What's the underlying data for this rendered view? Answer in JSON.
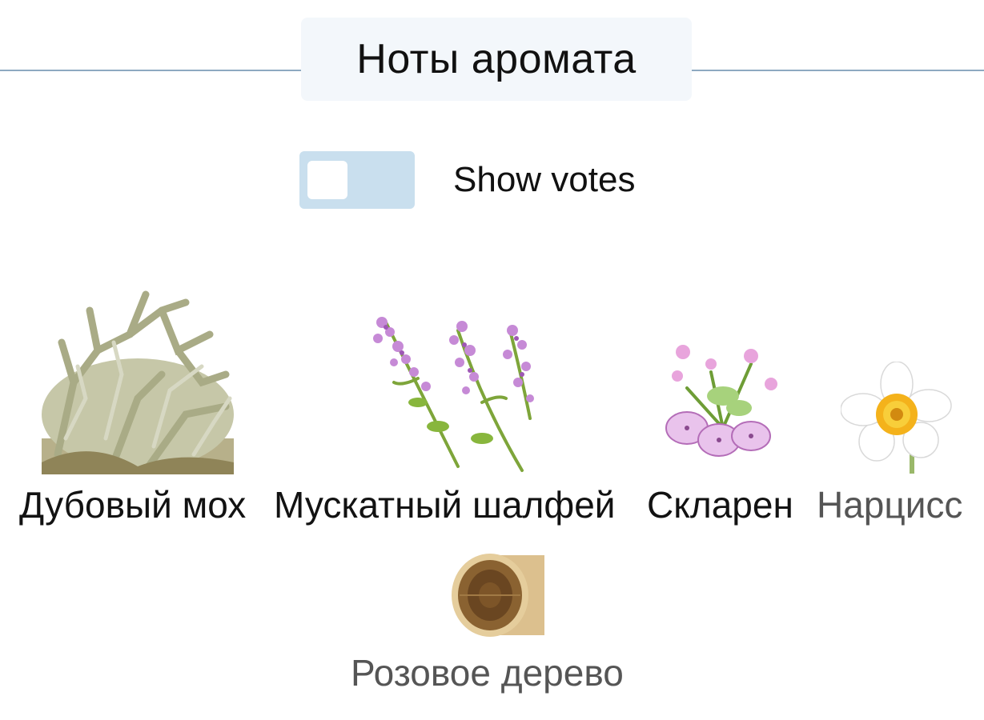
{
  "section": {
    "title": "Ноты аромата"
  },
  "votes_toggle": {
    "label": "Show votes",
    "enabled": false,
    "track_color": "#c9dfee"
  },
  "notes": [
    {
      "name": "Дубовый мох",
      "icon": "oakmoss-image"
    },
    {
      "name": "Мускатный шалфей",
      "icon": "clary-sage-image"
    },
    {
      "name": "Скларен",
      "icon": "sclareol-image"
    },
    {
      "name": "Нарцисс",
      "icon": "narcissus-image"
    },
    {
      "name": "Розовое дерево",
      "icon": "rosewood-image"
    }
  ],
  "colors": {
    "divider": "#8ea9c1",
    "title_bg": "#f3f7fb"
  }
}
